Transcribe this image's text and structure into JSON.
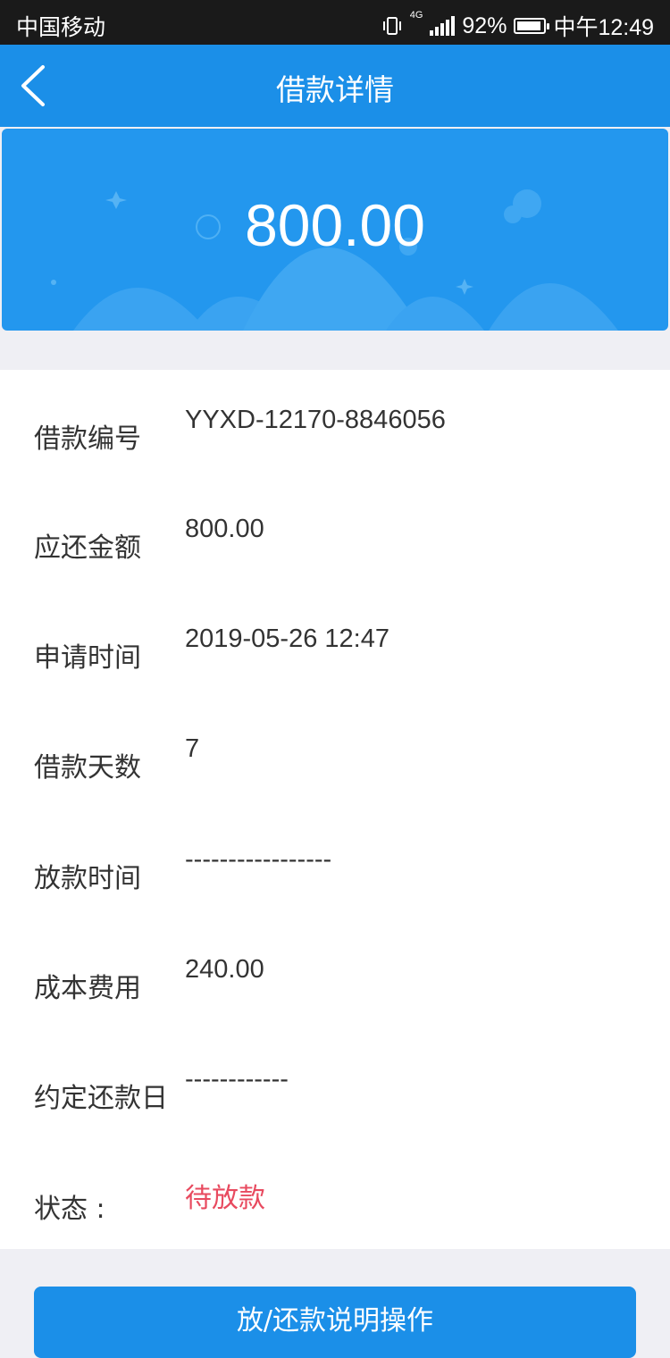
{
  "status_bar": {
    "carrier": "中国移动",
    "network": "4G",
    "battery": "92%",
    "battery_level": 0.92,
    "time": "中午12:49"
  },
  "header": {
    "title": "借款详情"
  },
  "hero": {
    "amount": "800.00"
  },
  "details": [
    {
      "label": "借款编号",
      "value": "YYXD-12170-8846056"
    },
    {
      "label": "应还金额",
      "value": "800.00"
    },
    {
      "label": "申请时间",
      "value": "2019-05-26 12:47"
    },
    {
      "label": "借款天数",
      "value": "7"
    },
    {
      "label": "放款时间",
      "value": "-----------------"
    },
    {
      "label": "成本费用",
      "value": "240.00"
    },
    {
      "label": "约定还款日",
      "value": "------------"
    },
    {
      "label": "状态 :",
      "value": "待放款"
    }
  ],
  "action": {
    "label": "放/还款说明操作"
  },
  "colors": {
    "primary": "#1b8fe8",
    "status_pending": "#e84a5f"
  }
}
